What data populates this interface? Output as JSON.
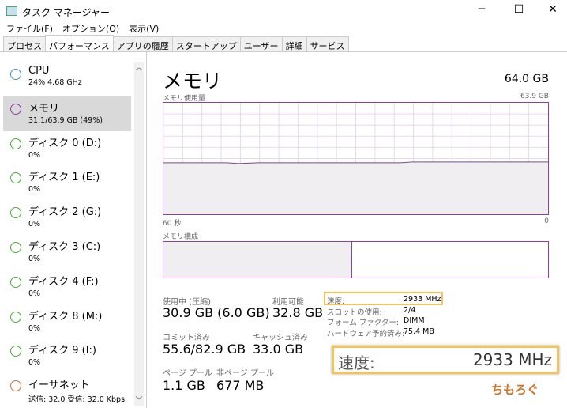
{
  "window": {
    "title": "タスク マネージャー"
  },
  "menu": [
    "ファイル(F)",
    "オプション(O)",
    "表示(V)"
  ],
  "tabs": [
    "プロセス",
    "パフォーマンス",
    "アプリの履歴",
    "スタートアップ",
    "ユーザー",
    "詳細",
    "サービス"
  ],
  "active_tab": 1,
  "sidebar": [
    {
      "name": "CPU",
      "sub": "24%  4.68 GHz",
      "color": "#4a90c8"
    },
    {
      "name": "メモリ",
      "sub": "31.1/63.9 GB (49%)",
      "color": "#8b3fa8",
      "selected": true
    },
    {
      "name": "ディスク 0 (D:)",
      "sub": "0%",
      "color": "#4caa3a"
    },
    {
      "name": "ディスク 1 (E:)",
      "sub": "0%",
      "color": "#4caa3a"
    },
    {
      "name": "ディスク 2 (G:)",
      "sub": "0%",
      "color": "#4caa3a"
    },
    {
      "name": "ディスク 3 (C:)",
      "sub": "0%",
      "color": "#4caa3a"
    },
    {
      "name": "ディスク 4 (F:)",
      "sub": "0%",
      "color": "#4caa3a"
    },
    {
      "name": "ディスク 8 (M:)",
      "sub": "0%",
      "color": "#4caa3a"
    },
    {
      "name": "ディスク 9 (I:)",
      "sub": "0%",
      "color": "#4caa3a"
    },
    {
      "name": "イーサネット",
      "sub": "送信: 32.0 受信: 32.0 Kbps",
      "color": "#c8703a"
    }
  ],
  "main": {
    "title": "メモリ",
    "total": "64.0 GB",
    "usage_label": "メモリ使用量",
    "usage_max": "63.9 GB",
    "time_left": "60 秒",
    "time_right": "0",
    "usage_percent": 49,
    "composition_label": "メモリ構成",
    "composition_in_use_percent": 49,
    "stats": {
      "in_use_label": "使用中 (圧縮)",
      "in_use": "30.9 GB (6.0 GB)",
      "available_label": "利用可能",
      "available": "32.8 GB",
      "committed_label": "コミット済み",
      "committed": "55.6/82.9 GB",
      "cached_label": "キャッシュ済み",
      "cached": "33.0 GB",
      "paged_label": "ページ プール",
      "paged": "1.1 GB",
      "nonpaged_label": "非ページ プール",
      "nonpaged": "677 MB"
    },
    "details": [
      {
        "k": "速度:",
        "v": "2933 MHz"
      },
      {
        "k": "スロットの使用:",
        "v": "2/4"
      },
      {
        "k": "フォーム ファクター:",
        "v": "DIMM"
      },
      {
        "k": "ハードウェア予約済み:",
        "v": "75.4 MB"
      }
    ],
    "callout": {
      "k": "速度:",
      "v": "2933 MHz"
    }
  },
  "watermark": "ちもろぐ",
  "accent": "#8b3fa8",
  "highlight": "#f3c35a"
}
